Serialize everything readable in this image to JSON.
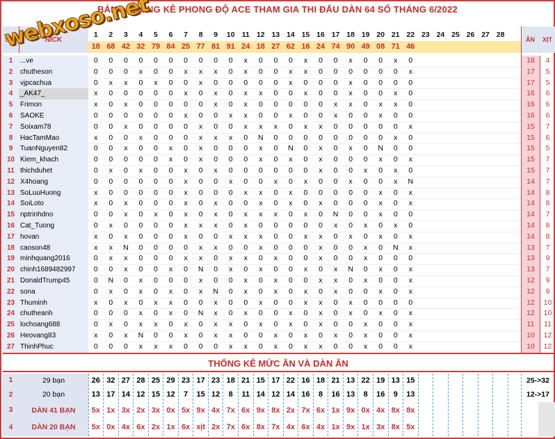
{
  "title": "BẢNG THỐNG KÊ PHONG ĐỘ ACE THAM GIA THI ĐẤU DÀN 64 SỐ THÁNG 6/2022",
  "logo_text": "webxoso.net",
  "header": {
    "stt": "STT",
    "nick": "NICK",
    "an": "ĂN",
    "xit": "XỊT"
  },
  "days": [
    "1",
    "2",
    "3",
    "4",
    "5",
    "6",
    "7",
    "8",
    "9",
    "10",
    "11",
    "12",
    "13",
    "14",
    "15",
    "16",
    "17",
    "18",
    "19",
    "20",
    "21",
    "22",
    "23",
    "24",
    "25",
    "26",
    "27",
    "28"
  ],
  "results": [
    "18",
    "68",
    "42",
    "32",
    "79",
    "84",
    "25",
    "77",
    "81",
    "91",
    "24",
    "18",
    "27",
    "62",
    "16",
    "24",
    "74",
    "90",
    "49",
    "08",
    "71",
    "46"
  ],
  "players": [
    {
      "stt": "1",
      "nick": "...ve",
      "cells": [
        "0",
        "0",
        "0",
        "0",
        "0",
        "0",
        "0",
        "0",
        "0",
        "0",
        "x",
        "0",
        "0",
        "0",
        "x",
        "0",
        "0",
        "x",
        "0",
        "0",
        "x",
        "0"
      ],
      "an": "18",
      "xit": "4"
    },
    {
      "stt": "2",
      "nick": "chutheson",
      "cells": [
        "0",
        "0",
        "0",
        "x",
        "0",
        "0",
        "x",
        "x",
        "x",
        "0",
        "x",
        "0",
        "0",
        "x",
        "x",
        "0",
        "0",
        "0",
        "0",
        "0",
        "0",
        "x"
      ],
      "an": "17",
      "xit": "5"
    },
    {
      "stt": "3",
      "nick": "vjpcachua",
      "cells": [
        "0",
        "x",
        "x",
        "0",
        "x",
        "0",
        "0",
        "x",
        "0",
        "0",
        "0",
        "0",
        "0",
        "x",
        "0",
        "0",
        "0",
        "x",
        "0",
        "0",
        "0",
        "0"
      ],
      "an": "17",
      "xit": "5"
    },
    {
      "stt": "4",
      "nick": "_AK47_",
      "cells": [
        "x",
        "0",
        "0",
        "0",
        "0",
        "0",
        "x",
        "0",
        "x",
        "0",
        "x",
        "x",
        "0",
        "0",
        "x",
        "0",
        "0",
        "x",
        "0",
        "0",
        "x",
        "0"
      ],
      "an": "16",
      "xit": "6"
    },
    {
      "stt": "5",
      "nick": "Frimon",
      "cells": [
        "x",
        "0",
        "x",
        "0",
        "0",
        "0",
        "0",
        "0",
        "x",
        "0",
        "x",
        "0",
        "0",
        "0",
        "0",
        "0",
        "x",
        "x",
        "0",
        "x",
        "x",
        "0"
      ],
      "an": "16",
      "xit": "6"
    },
    {
      "stt": "6",
      "nick": "SAOKE",
      "cells": [
        "0",
        "0",
        "0",
        "0",
        "0",
        "0",
        "x",
        "0",
        "0",
        "x",
        "x",
        "0",
        "0",
        "x",
        "0",
        "0",
        "x",
        "0",
        "0",
        "x",
        "0",
        "0"
      ],
      "an": "16",
      "xit": "6"
    },
    {
      "stt": "7",
      "nick": "Soixam78",
      "cells": [
        "0",
        "0",
        "x",
        "0",
        "0",
        "0",
        "0",
        "x",
        "0",
        "0",
        "x",
        "x",
        "x",
        "0",
        "x",
        "x",
        "0",
        "0",
        "0",
        "0",
        "0",
        "x"
      ],
      "an": "15",
      "xit": "7"
    },
    {
      "stt": "8",
      "nick": "HacTamMao",
      "cells": [
        "x",
        "0",
        "0",
        "x",
        "0",
        "0",
        "0",
        "x",
        "x",
        "x",
        "0",
        "N",
        "0",
        "0",
        "0",
        "0",
        "0",
        "0",
        "0",
        "0",
        "x",
        "0"
      ],
      "an": "15",
      "xit": "6"
    },
    {
      "stt": "9",
      "nick": "TuanNguyen82",
      "cells": [
        "0",
        "0",
        "x",
        "0",
        "0",
        "x",
        "0",
        "x",
        "0",
        "0",
        "0",
        "x",
        "0",
        "N",
        "0",
        "x",
        "0",
        "x",
        "0",
        "N",
        "0",
        "0"
      ],
      "an": "15",
      "xit": "5"
    },
    {
      "stt": "10",
      "nick": "Kiem_khach",
      "cells": [
        "0",
        "0",
        "0",
        "0",
        "0",
        "x",
        "0",
        "x",
        "0",
        "0",
        "0",
        "x",
        "0",
        "x",
        "0",
        "x",
        "0",
        "0",
        "0",
        "x",
        "0",
        "x"
      ],
      "an": "15",
      "xit": "7"
    },
    {
      "stt": "11",
      "nick": "thichduhet",
      "cells": [
        "0",
        "x",
        "0",
        "x",
        "0",
        "0",
        "x",
        "0",
        "x",
        "0",
        "0",
        "0",
        "0",
        "0",
        "0",
        "x",
        "0",
        "0",
        "x",
        "0",
        "x",
        "0"
      ],
      "an": "15",
      "xit": "7"
    },
    {
      "stt": "12",
      "nick": "X4hoang",
      "cells": [
        "0",
        "0",
        "0",
        "0",
        "0",
        "0",
        "x",
        "0",
        "0",
        "x",
        "0",
        "0",
        "x",
        "0",
        "x",
        "0",
        "0",
        "x",
        "0",
        "0",
        "x",
        "N"
      ],
      "an": "14",
      "xit": "7"
    },
    {
      "stt": "13",
      "nick": "SoLuuHuong",
      "cells": [
        "x",
        "0",
        "0",
        "0",
        "0",
        "0",
        "x",
        "0",
        "0",
        "0",
        "x",
        "x",
        "0",
        "x",
        "0",
        "0",
        "0",
        "0",
        "0",
        "x",
        "0",
        "x"
      ],
      "an": "14",
      "xit": "8"
    },
    {
      "stt": "14",
      "nick": "SoiLoto",
      "cells": [
        "x",
        "0",
        "x",
        "0",
        "0",
        "0",
        "x",
        "0",
        "x",
        "0",
        "0",
        "x",
        "0",
        "x",
        "0",
        "x",
        "0",
        "0",
        "0",
        "x",
        "0",
        "x"
      ],
      "an": "14",
      "xit": "8"
    },
    {
      "stt": "15",
      "nick": "nptrinhdno",
      "cells": [
        "0",
        "0",
        "x",
        "0",
        "x",
        "0",
        "x",
        "0",
        "x",
        "0",
        "x",
        "x",
        "x",
        "0",
        "x",
        "0",
        "N",
        "0",
        "0",
        "x",
        "0",
        "0"
      ],
      "an": "14",
      "xit": "7"
    },
    {
      "stt": "16",
      "nick": "Cat_Tuong",
      "cells": [
        "0",
        "x",
        "0",
        "0",
        "0",
        "0",
        "x",
        "x",
        "x",
        "0",
        "x",
        "0",
        "0",
        "0",
        "0",
        "0",
        "x",
        "0",
        "x",
        "0",
        "x",
        "0"
      ],
      "an": "14",
      "xit": "8"
    },
    {
      "stt": "17",
      "nick": "hovan",
      "cells": [
        "x",
        "0",
        "x",
        "0",
        "0",
        "0",
        "x",
        "0",
        "0",
        "x",
        "x",
        "x",
        "0",
        "0",
        "x",
        "x",
        "0",
        "x",
        "0",
        "x",
        "0",
        "x"
      ],
      "an": "14",
      "xit": "8"
    },
    {
      "stt": "18",
      "nick": "caoson48",
      "cells": [
        "x",
        "x",
        "N",
        "0",
        "0",
        "0",
        "0",
        "x",
        "x",
        "0",
        "0",
        "x",
        "0",
        "0",
        "0",
        "x",
        "0",
        "0",
        "x",
        "0",
        "N",
        "x"
      ],
      "an": "13",
      "xit": "7"
    },
    {
      "stt": "19",
      "nick": "minhquang2016",
      "cells": [
        "0",
        "x",
        "x",
        "0",
        "0",
        "0",
        "x",
        "x",
        "0",
        "x",
        "x",
        "0",
        "x",
        "0",
        "0",
        "x",
        "0",
        "0",
        "x",
        "0",
        "0",
        "0"
      ],
      "an": "13",
      "xit": "9"
    },
    {
      "stt": "20",
      "nick": "chinh1689482997",
      "cells": [
        "0",
        "0",
        "x",
        "0",
        "0",
        "x",
        "0",
        "N",
        "0",
        "x",
        "0",
        "x",
        "0",
        "0",
        "x",
        "0",
        "x",
        "N",
        "0",
        "x",
        "0",
        "x"
      ],
      "an": "13",
      "xit": "7"
    },
    {
      "stt": "21",
      "nick": "DonaldTrump45",
      "cells": [
        "0",
        "N",
        "0",
        "x",
        "0",
        "0",
        "0",
        "x",
        "0",
        "0",
        "x",
        "0",
        "x",
        "0",
        "0",
        "x",
        "x",
        "0",
        "x",
        "0",
        "0",
        "x"
      ],
      "an": "12",
      "xit": "9"
    },
    {
      "stt": "22",
      "nick": "sona",
      "cells": [
        "0",
        "x",
        "0",
        "x",
        "0",
        "x",
        "0",
        "x",
        "N",
        "0",
        "x",
        "0",
        "x",
        "0",
        "x",
        "0",
        "x",
        "0",
        "0",
        "x",
        "0",
        "x"
      ],
      "an": "12",
      "xit": "9"
    },
    {
      "stt": "23",
      "nick": "Thuminh",
      "cells": [
        "x",
        "0",
        "x",
        "0",
        "x",
        "x",
        "0",
        "0",
        "x",
        "0",
        "0",
        "x",
        "0",
        "0",
        "x",
        "x",
        "0",
        "x",
        "0",
        "0",
        "0",
        "0"
      ],
      "an": "12",
      "xit": "10"
    },
    {
      "stt": "24",
      "nick": "chutheanh",
      "cells": [
        "0",
        "0",
        "0",
        "x",
        "0",
        "x",
        "0",
        "N",
        "x",
        "0",
        "x",
        "0",
        "0",
        "x",
        "0",
        "x",
        "0",
        "x",
        "0",
        "x",
        "0",
        "x"
      ],
      "an": "12",
      "xit": "10"
    },
    {
      "stt": "25",
      "nick": "lochoang688",
      "cells": [
        "0",
        "x",
        "0",
        "x",
        "x",
        "0",
        "x",
        "0",
        "x",
        "x",
        "0",
        "x",
        "0",
        "x",
        "0",
        "x",
        "0",
        "0",
        "x",
        "0",
        "0",
        "x"
      ],
      "an": "11",
      "xit": "11"
    },
    {
      "stt": "26",
      "nick": "Heovang83",
      "cells": [
        "x",
        "0",
        "x",
        "N",
        "0",
        "0",
        "x",
        "0",
        "x",
        "x",
        "0",
        "0",
        "x",
        "0",
        "x",
        "0",
        "x",
        "0",
        "x",
        "0",
        "0",
        "x"
      ],
      "an": "10",
      "xit": "12"
    },
    {
      "stt": "27",
      "nick": "ThinhPhuc",
      "cells": [
        "0",
        "0",
        "0",
        "x",
        "x",
        "x",
        "0",
        "0",
        "0",
        "x",
        "x",
        "0",
        "x",
        "0",
        "x",
        "x",
        "0",
        "0",
        "x",
        "0",
        "0",
        "x"
      ],
      "an": "10",
      "xit": "12"
    }
  ],
  "footer": {
    "title": "THỐNG KÊ MỨC ĂN VÀ DÀN ĂN",
    "rows": [
      {
        "stt": "1",
        "label": "29 bạn",
        "values": [
          "26",
          "32",
          "27",
          "28",
          "25",
          "29",
          "23",
          "17",
          "23",
          "18",
          "21",
          "15",
          "17",
          "22",
          "16",
          "18",
          "21",
          "13",
          "22",
          "19",
          "13",
          "15"
        ],
        "right": "25->32"
      },
      {
        "stt": "2",
        "label": "20 bạn",
        "values": [
          "13",
          "17",
          "14",
          "12",
          "15",
          "12",
          "7",
          "15",
          "12",
          "8",
          "11",
          "14",
          "12",
          "14",
          "16",
          "8",
          "16",
          "13",
          "8",
          "16",
          "9",
          "13"
        ],
        "right": "12->17"
      },
      {
        "stt": "3",
        "label": "DÀN 41 BẠN",
        "values": [
          "5x",
          "1x",
          "3x",
          "2x",
          "3x",
          "0x",
          "5x",
          "9x",
          "4x",
          "7x",
          "6x",
          "9x",
          "8x",
          "2x",
          "7x",
          "6x",
          "1x",
          "9x",
          "0x",
          "4x",
          "8x",
          "8x"
        ],
        "right": ""
      },
      {
        "stt": "4",
        "label": "DÀN 20 BẠN",
        "values": [
          "5x",
          "0x",
          "4x",
          "6x",
          "2x",
          "1x",
          "6x",
          "xịt",
          "2x",
          "7x",
          "6x",
          "8x",
          "7x",
          "4x",
          "6x",
          "4x",
          "1x",
          "9x",
          "1x",
          "3x",
          "8x",
          "5x"
        ],
        "right": ""
      }
    ]
  }
}
